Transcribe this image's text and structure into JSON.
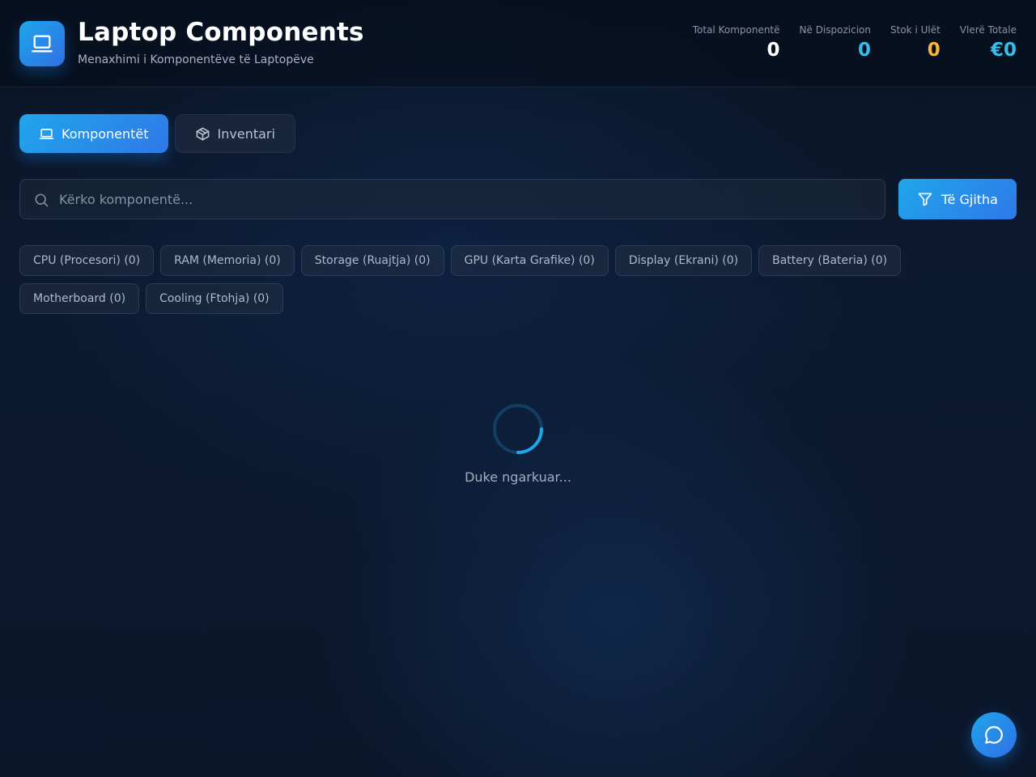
{
  "header": {
    "title": "Laptop Components",
    "subtitle": "Menaxhimi i Komponentëve të Laptopëve",
    "logo_icon": "laptop-icon",
    "stats": [
      {
        "label": "Total Komponentë",
        "value": "0",
        "color": "#ffffff"
      },
      {
        "label": "Në Dispozicion",
        "value": "0",
        "color": "#38bde8"
      },
      {
        "label": "Stok i Ulët",
        "value": "0",
        "color": "#f4b63c"
      },
      {
        "label": "Vlerë Totale",
        "value": "€0",
        "color": "#38bde8"
      }
    ]
  },
  "tabs": [
    {
      "label": "Komponentët",
      "icon": "laptop-icon",
      "active": true
    },
    {
      "label": "Inventari",
      "icon": "box-icon",
      "active": false
    }
  ],
  "search": {
    "placeholder": "Kërko komponentë...",
    "value": "",
    "icon": "search-icon"
  },
  "filter": {
    "label": "Të Gjitha",
    "icon": "filter-icon"
  },
  "categories": [
    "CPU (Procesori) (0)",
    "RAM (Memoria) (0)",
    "Storage (Ruajtja) (0)",
    "GPU (Karta Grafike) (0)",
    "Display (Ekrani) (0)",
    "Battery (Bateria) (0)",
    "Motherboard (0)",
    "Cooling (Ftohja) (0)"
  ],
  "loading": {
    "text": "Duke ngarkuar..."
  },
  "chat": {
    "icon": "chat-icon"
  },
  "colors": {
    "accent": "#1fa6ea",
    "accent_end": "#2f78e8",
    "warning": "#f4b63c"
  }
}
